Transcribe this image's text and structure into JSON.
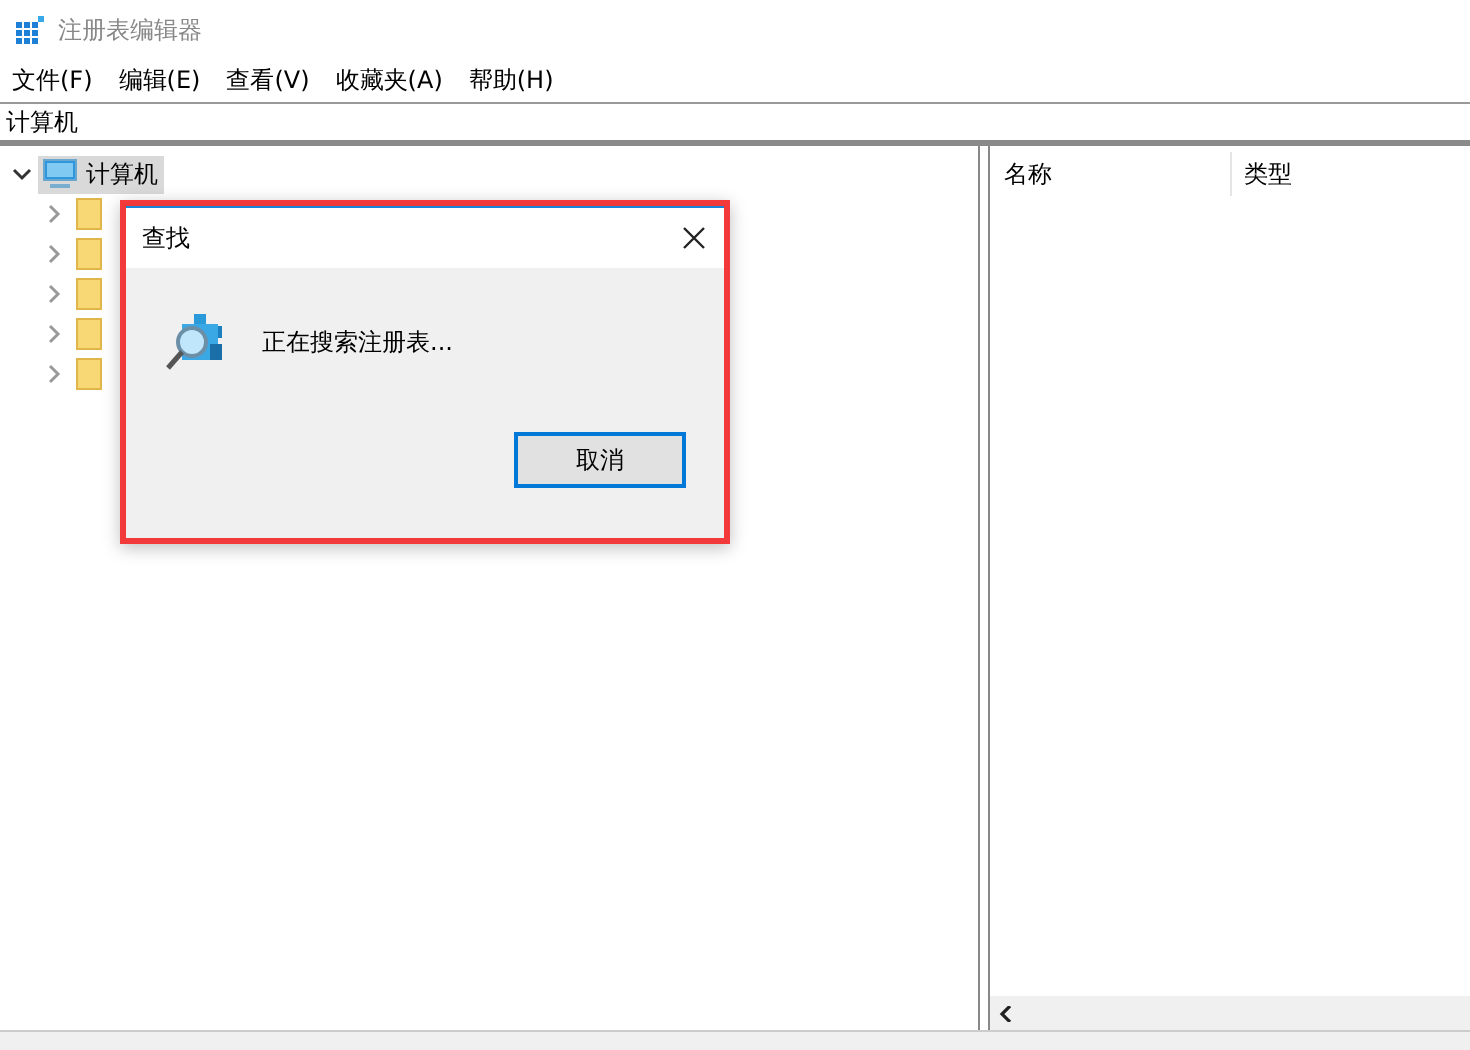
{
  "window": {
    "title": "注册表编辑器"
  },
  "menu": [
    {
      "label": "文件(F)"
    },
    {
      "label": "编辑(E)"
    },
    {
      "label": "查看(V)"
    },
    {
      "label": "收藏夹(A)"
    },
    {
      "label": "帮助(H)"
    }
  ],
  "address": {
    "value": "计算机"
  },
  "tree": {
    "label": "计算机",
    "selected": true,
    "expanded": true,
    "children": [
      {
        "kind": "folder",
        "expanded": false
      },
      {
        "kind": "folder",
        "expanded": false
      },
      {
        "kind": "folder",
        "expanded": false
      },
      {
        "kind": "folder",
        "expanded": false
      },
      {
        "kind": "folder",
        "expanded": false
      }
    ]
  },
  "list": {
    "columns": [
      "名称",
      "类型"
    ]
  },
  "dialog": {
    "title": "查找",
    "message": "正在搜索注册表...",
    "button": "取消",
    "highlighted": true
  }
}
